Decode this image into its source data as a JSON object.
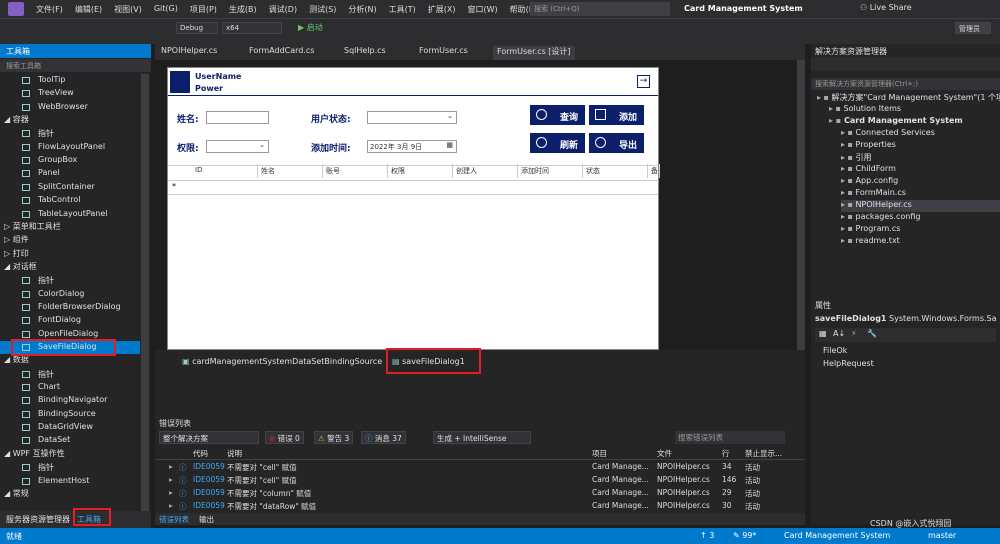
{
  "menubar": {
    "items": [
      "文件(F)",
      "编辑(E)",
      "视图(V)",
      "Git(G)",
      "项目(P)",
      "生成(B)",
      "调试(D)",
      "测试(S)",
      "分析(N)",
      "工具(T)",
      "扩展(X)",
      "窗口(W)",
      "帮助(H)"
    ],
    "search_placeholder": "搜索 (Ctrl+Q)",
    "app_title": "Card Management System",
    "live_share": "Live Share",
    "admin": "管理员"
  },
  "toolbar": {
    "config": "Debug",
    "platform": "x64",
    "start": "▶ 启动"
  },
  "toolbox": {
    "title": "工具箱",
    "search": "搜索工具箱",
    "items": [
      {
        "type": "item",
        "label": "ToolTip"
      },
      {
        "type": "item",
        "label": "TreeView"
      },
      {
        "type": "item",
        "label": "WebBrowser"
      },
      {
        "type": "cat",
        "label": "◢ 容器"
      },
      {
        "type": "item",
        "label": "指针"
      },
      {
        "type": "item",
        "label": "FlowLayoutPanel"
      },
      {
        "type": "item",
        "label": "GroupBox"
      },
      {
        "type": "item",
        "label": "Panel"
      },
      {
        "type": "item",
        "label": "SplitContainer"
      },
      {
        "type": "item",
        "label": "TabControl"
      },
      {
        "type": "item",
        "label": "TableLayoutPanel"
      },
      {
        "type": "cat",
        "label": "▷ 菜单和工具栏"
      },
      {
        "type": "cat",
        "label": "▷ 组件"
      },
      {
        "type": "cat",
        "label": "▷ 打印"
      },
      {
        "type": "cat",
        "label": "◢ 对话框"
      },
      {
        "type": "item",
        "label": "指针"
      },
      {
        "type": "item",
        "label": "ColorDialog"
      },
      {
        "type": "item",
        "label": "FolderBrowserDialog"
      },
      {
        "type": "item",
        "label": "FontDialog"
      },
      {
        "type": "item",
        "label": "OpenFileDialog"
      },
      {
        "type": "sel",
        "label": "SaveFileDialog"
      },
      {
        "type": "cat",
        "label": "◢ 数据"
      },
      {
        "type": "item",
        "label": "指针"
      },
      {
        "type": "item",
        "label": "Chart"
      },
      {
        "type": "item",
        "label": "BindingNavigator"
      },
      {
        "type": "item",
        "label": "BindingSource"
      },
      {
        "type": "item",
        "label": "DataGridView"
      },
      {
        "type": "item",
        "label": "DataSet"
      },
      {
        "type": "cat",
        "label": "◢ WPF 互操作性"
      },
      {
        "type": "item",
        "label": "指针"
      },
      {
        "type": "item",
        "label": "ElementHost"
      },
      {
        "type": "cat",
        "label": "◢ 常规"
      }
    ],
    "bottom_tabs": [
      "服务器资源管理器",
      "工具箱"
    ]
  },
  "doc_tabs": [
    "NPOIHelper.cs",
    "FormAddCard.cs",
    "SqlHelp.cs",
    "FormUser.cs",
    "FormUser.cs [设计]"
  ],
  "form": {
    "username": "UserName",
    "power": "Power",
    "name_label": "姓名:",
    "status_label": "用户状态:",
    "perm_label": "权限:",
    "date_label": "添加时间:",
    "date_value": "2022年  3月  9日",
    "btn_query": "查询",
    "btn_add": "添加",
    "btn_refresh": "刷新",
    "btn_export": "导出",
    "columns": [
      "ID",
      "姓名",
      "账号",
      "权限",
      "创建人",
      "添加时间",
      "状态",
      "备"
    ],
    "new_row_marker": "*"
  },
  "tray": {
    "items": [
      "cardManagementSystemDataSetBindingSource",
      "saveFileDialog1"
    ]
  },
  "errlist": {
    "title": "错误列表",
    "scope": "整个解决方案",
    "errors": "错误 0",
    "warnings": "警告 3",
    "messages": "消息 37",
    "build": "生成 + IntelliSense",
    "search": "搜索错误列表",
    "headers": [
      "代码",
      "说明",
      "项目",
      "文件",
      "行",
      "禁止显示..."
    ],
    "rows": [
      {
        "code": "IDE0059",
        "desc": "不需要对 \"cell\" 赋值",
        "project": "Card Manage...",
        "file": "NPOIHelper.cs",
        "line": "34",
        "state": "活动"
      },
      {
        "code": "IDE0059",
        "desc": "不需要对 \"cell\" 赋值",
        "project": "Card Manage...",
        "file": "NPOIHelper.cs",
        "line": "146",
        "state": "活动"
      },
      {
        "code": "IDE0059",
        "desc": "不需要对 \"column\" 赋值",
        "project": "Card Manage...",
        "file": "NPOIHelper.cs",
        "line": "29",
        "state": "活动"
      },
      {
        "code": "IDE0059",
        "desc": "不需要对 \"dataRow\" 赋值",
        "project": "Card Manage...",
        "file": "NPOIHelper.cs",
        "line": "30",
        "state": "活动"
      }
    ],
    "bottom_tabs": [
      "错误列表",
      "输出"
    ]
  },
  "solexp": {
    "title": "解决方案资源管理器",
    "search": "搜索解决方案资源管理器(Ctrl+;)",
    "nodes": [
      {
        "indent": 0,
        "label": "解决方案\"Card Management System\"(1 个项"
      },
      {
        "indent": 1,
        "label": "Solution Items"
      },
      {
        "indent": 1,
        "label": "Card Management System",
        "bold": true
      },
      {
        "indent": 2,
        "label": "Connected Services"
      },
      {
        "indent": 2,
        "label": "Properties"
      },
      {
        "indent": 2,
        "label": "引用"
      },
      {
        "indent": 2,
        "label": "ChildForm"
      },
      {
        "indent": 2,
        "label": "App.config"
      },
      {
        "indent": 2,
        "label": "FormMain.cs"
      },
      {
        "indent": 2,
        "label": "NPOIHelper.cs",
        "selected": true
      },
      {
        "indent": 2,
        "label": "packages.config"
      },
      {
        "indent": 2,
        "label": "Program.cs"
      },
      {
        "indent": 2,
        "label": "readme.txt"
      }
    ]
  },
  "props": {
    "title": "属性",
    "object": "saveFileDialog1",
    "type": "System.Windows.Forms.Sav",
    "events": [
      "FileOk",
      "HelpRequest"
    ]
  },
  "status": {
    "ready": "就绪",
    "pos": "↑ 3",
    "pen": "✎ 99*",
    "project": "Card Management System",
    "branch": "master",
    "watermark": "CSDN @嵌入式悦翔园"
  }
}
